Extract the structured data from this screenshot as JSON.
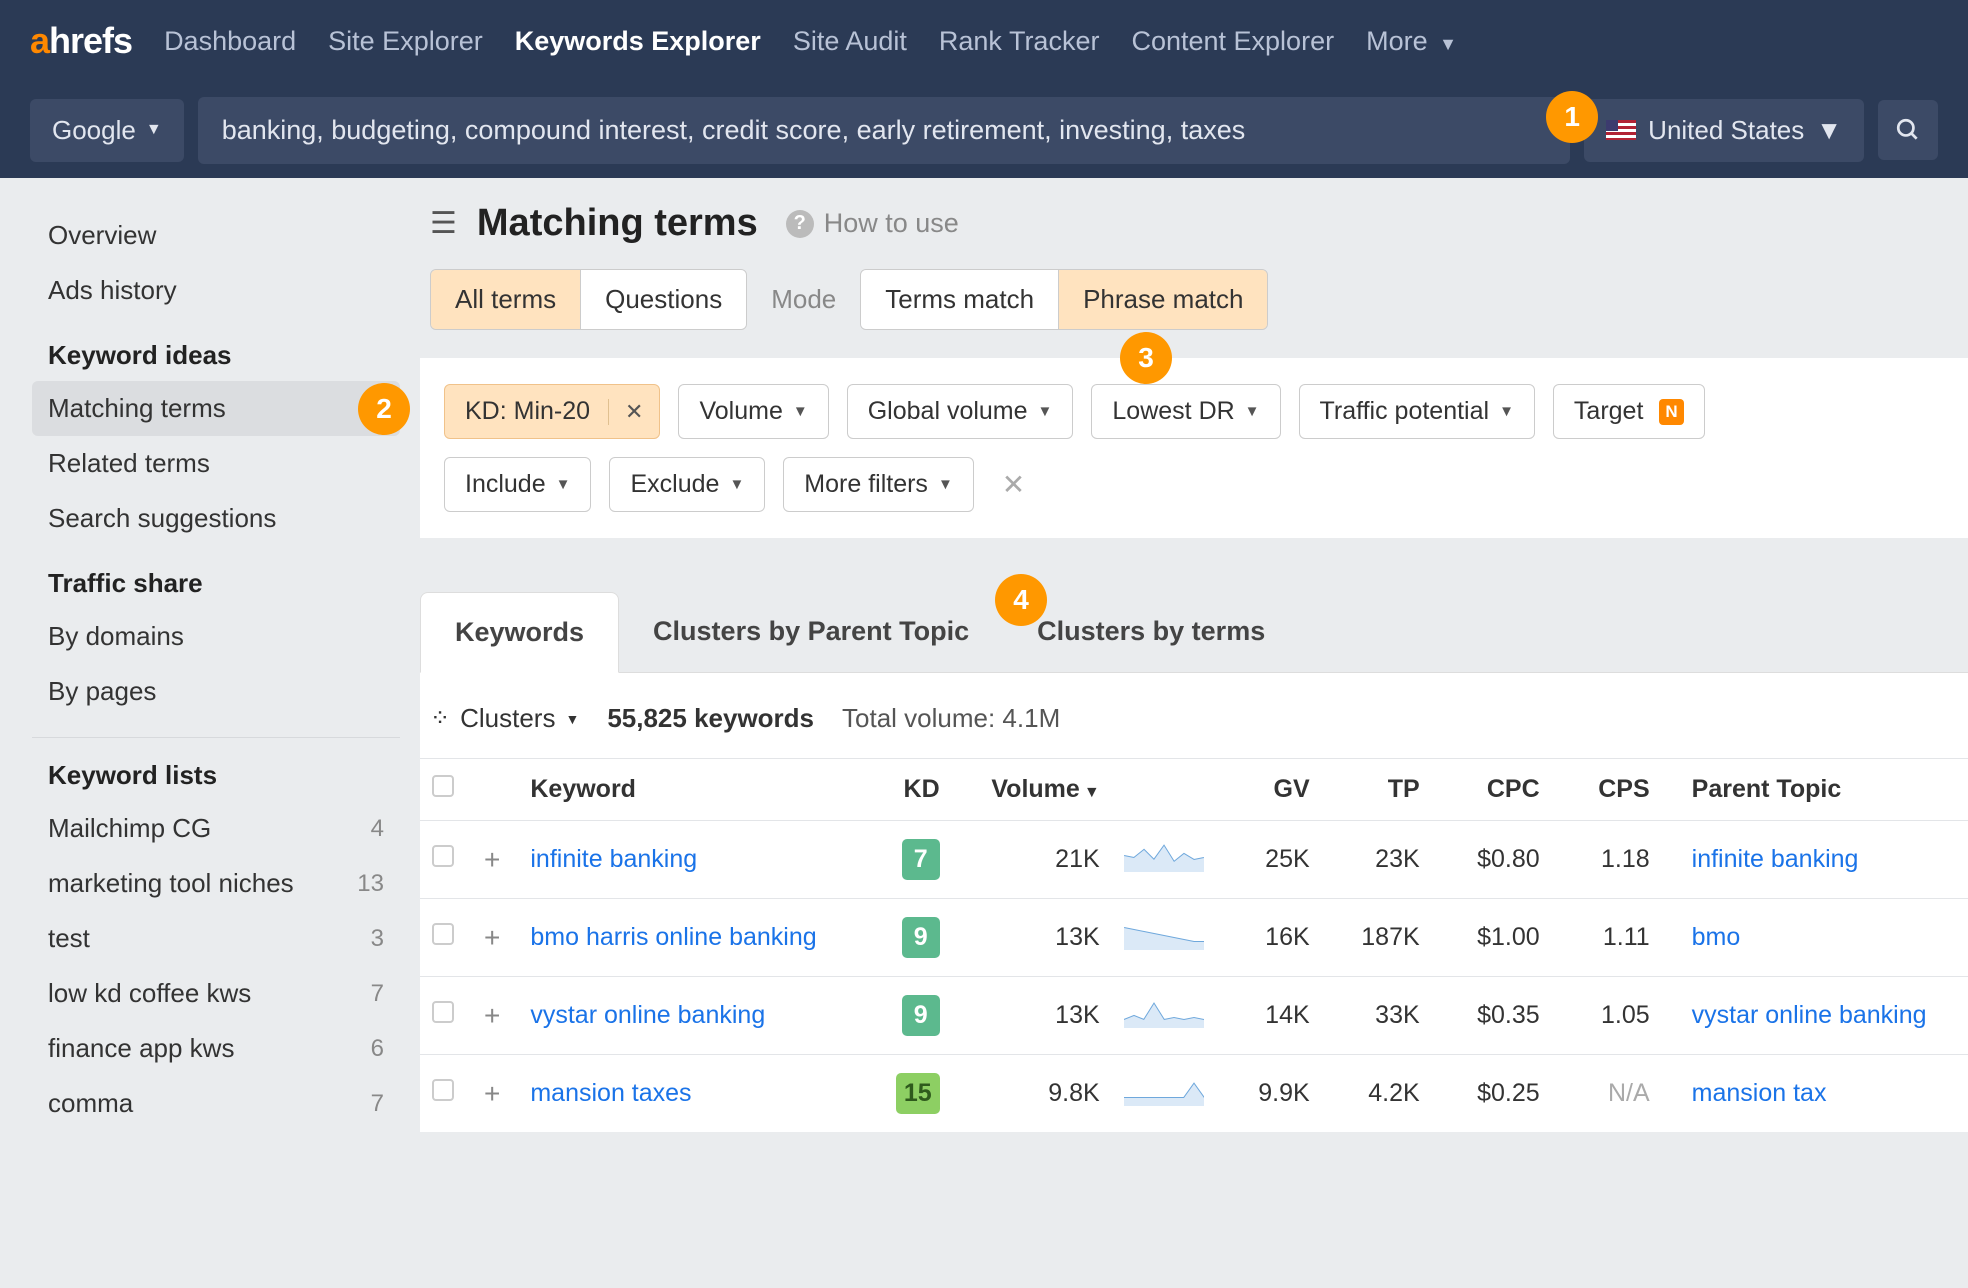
{
  "nav": {
    "logo_a": "a",
    "logo_rest": "hrefs",
    "items": [
      {
        "label": "Dashboard"
      },
      {
        "label": "Site Explorer"
      },
      {
        "label": "Keywords Explorer",
        "active": true
      },
      {
        "label": "Site Audit"
      },
      {
        "label": "Rank Tracker"
      },
      {
        "label": "Content Explorer"
      },
      {
        "label": "More"
      }
    ]
  },
  "searchbar": {
    "engine": "Google",
    "keywords": "banking, budgeting, compound interest, credit score, early retirement, investing, taxes",
    "country": "United States"
  },
  "badges": {
    "b1": "1",
    "b2": "2",
    "b3": "3",
    "b4": "4"
  },
  "sidebar": {
    "top": [
      {
        "label": "Overview"
      },
      {
        "label": "Ads history"
      }
    ],
    "keyword_ideas_heading": "Keyword ideas",
    "keyword_ideas": [
      {
        "label": "Matching terms",
        "selected": true
      },
      {
        "label": "Related terms"
      },
      {
        "label": "Search suggestions"
      }
    ],
    "traffic_heading": "Traffic share",
    "traffic": [
      {
        "label": "By domains"
      },
      {
        "label": "By pages"
      }
    ],
    "lists_heading": "Keyword lists",
    "lists": [
      {
        "label": "Mailchimp CG",
        "count": "4"
      },
      {
        "label": "marketing tool niches",
        "count": "13"
      },
      {
        "label": "test",
        "count": "3"
      },
      {
        "label": "low kd coffee kws",
        "count": "7"
      },
      {
        "label": "finance app kws",
        "count": "6"
      },
      {
        "label": "comma",
        "count": "7"
      }
    ]
  },
  "header": {
    "title": "Matching terms",
    "how_to": "How to use"
  },
  "segments": {
    "terms": [
      {
        "label": "All terms",
        "active": true
      },
      {
        "label": "Questions"
      }
    ],
    "mode_label": "Mode",
    "match": [
      {
        "label": "Terms match"
      },
      {
        "label": "Phrase match",
        "active": true
      }
    ]
  },
  "filters": {
    "kd": "KD: Min-20",
    "row1": [
      {
        "label": "Volume"
      },
      {
        "label": "Global volume"
      },
      {
        "label": "Lowest DR"
      },
      {
        "label": "Traffic potential"
      },
      {
        "label": "Target",
        "new": true
      }
    ],
    "row2": [
      {
        "label": "Include"
      },
      {
        "label": "Exclude"
      },
      {
        "label": "More filters"
      }
    ]
  },
  "result_tabs": [
    {
      "label": "Keywords",
      "active": true
    },
    {
      "label": "Clusters by Parent Topic"
    },
    {
      "label": "Clusters by terms"
    }
  ],
  "stats": {
    "clusters": "Clusters",
    "count": "55,825 keywords",
    "total": "Total volume: 4.1M"
  },
  "table": {
    "cols": {
      "keyword": "Keyword",
      "kd": "KD",
      "volume": "Volume",
      "gv": "GV",
      "tp": "TP",
      "cpc": "CPC",
      "cps": "CPS",
      "parent": "Parent Topic"
    },
    "rows": [
      {
        "keyword": "infinite banking",
        "kd": "7",
        "kd_cls": "kd-7",
        "volume": "21K",
        "gv": "25K",
        "tp": "23K",
        "cpc": "$0.80",
        "cps": "1.18",
        "parent": "infinite banking"
      },
      {
        "keyword": "bmo harris online banking",
        "kd": "9",
        "kd_cls": "kd-9",
        "volume": "13K",
        "gv": "16K",
        "tp": "187K",
        "cpc": "$1.00",
        "cps": "1.11",
        "parent": "bmo"
      },
      {
        "keyword": "vystar online banking",
        "kd": "9",
        "kd_cls": "kd-9",
        "volume": "13K",
        "gv": "14K",
        "tp": "33K",
        "cpc": "$0.35",
        "cps": "1.05",
        "parent": "vystar online banking"
      },
      {
        "keyword": "mansion taxes",
        "kd": "15",
        "kd_cls": "kd-15",
        "volume": "9.8K",
        "gv": "9.9K",
        "tp": "4.2K",
        "cpc": "$0.25",
        "cps": "N/A",
        "parent": "mansion tax"
      }
    ]
  }
}
